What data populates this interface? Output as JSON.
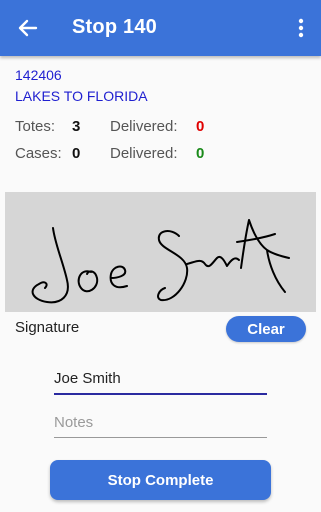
{
  "appbar": {
    "title": "Stop 140",
    "back_icon": "arrow-left-icon",
    "menu_icon": "more-vertical-icon"
  },
  "stop": {
    "id": "142406",
    "name": "LAKES TO FLORIDA"
  },
  "totes": {
    "label": "Totes:",
    "count": "3",
    "delivered_label": "Delivered:",
    "delivered": "0",
    "delivered_color": "#e00000"
  },
  "cases": {
    "label": "Cases:",
    "count": "0",
    "delivered_label": "Delivered:",
    "delivered": "0",
    "delivered_color": "#1a8a1a"
  },
  "signature": {
    "label": "Signature",
    "clear_label": "Clear",
    "handwritten_text": "Joe Smith"
  },
  "form": {
    "name_value": "Joe Smith",
    "notes_placeholder": "Notes"
  },
  "actions": {
    "complete_label": "Stop Complete"
  },
  "colors": {
    "primary": "#3b73d9",
    "link_text": "#1f1fd0"
  }
}
